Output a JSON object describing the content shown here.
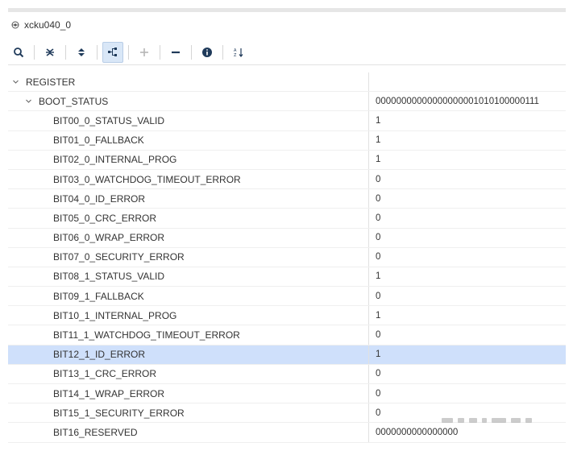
{
  "window": {
    "title": "xcku040_0"
  },
  "toolbar": {
    "buttons": [
      {
        "icon": "search-icon"
      },
      {
        "icon": "collapse-all-icon"
      },
      {
        "icon": "expand-all-icon"
      },
      {
        "icon": "hierarchy-icon",
        "active": true
      },
      {
        "icon": "plus-icon"
      },
      {
        "icon": "minus-icon"
      },
      {
        "icon": "info-icon"
      },
      {
        "icon": "sort-icon"
      }
    ]
  },
  "tree": {
    "root": {
      "label": "REGISTER",
      "value": ""
    },
    "register": {
      "label": "BOOT_STATUS",
      "value": "00000000000000000001010100000111"
    },
    "bits": [
      {
        "label": "BIT00_0_STATUS_VALID",
        "value": "1"
      },
      {
        "label": "BIT01_0_FALLBACK",
        "value": "1"
      },
      {
        "label": "BIT02_0_INTERNAL_PROG",
        "value": "1"
      },
      {
        "label": "BIT03_0_WATCHDOG_TIMEOUT_ERROR",
        "value": "0"
      },
      {
        "label": "BIT04_0_ID_ERROR",
        "value": "0"
      },
      {
        "label": "BIT05_0_CRC_ERROR",
        "value": "0"
      },
      {
        "label": "BIT06_0_WRAP_ERROR",
        "value": "0"
      },
      {
        "label": "BIT07_0_SECURITY_ERROR",
        "value": "0"
      },
      {
        "label": "BIT08_1_STATUS_VALID",
        "value": "1"
      },
      {
        "label": "BIT09_1_FALLBACK",
        "value": "0"
      },
      {
        "label": "BIT10_1_INTERNAL_PROG",
        "value": "1"
      },
      {
        "label": "BIT11_1_WATCHDOG_TIMEOUT_ERROR",
        "value": "0"
      },
      {
        "label": "BIT12_1_ID_ERROR",
        "value": "1"
      },
      {
        "label": "BIT13_1_CRC_ERROR",
        "value": "0"
      },
      {
        "label": "BIT14_1_WRAP_ERROR",
        "value": "0"
      },
      {
        "label": "BIT15_1_SECURITY_ERROR",
        "value": "0"
      },
      {
        "label": "BIT16_RESERVED",
        "value": "0000000000000000"
      }
    ],
    "selected_bit": "BIT12_1_ID_ERROR"
  },
  "colors": {
    "selection": "#cfe0fb",
    "accent": "#1a5fb4"
  }
}
